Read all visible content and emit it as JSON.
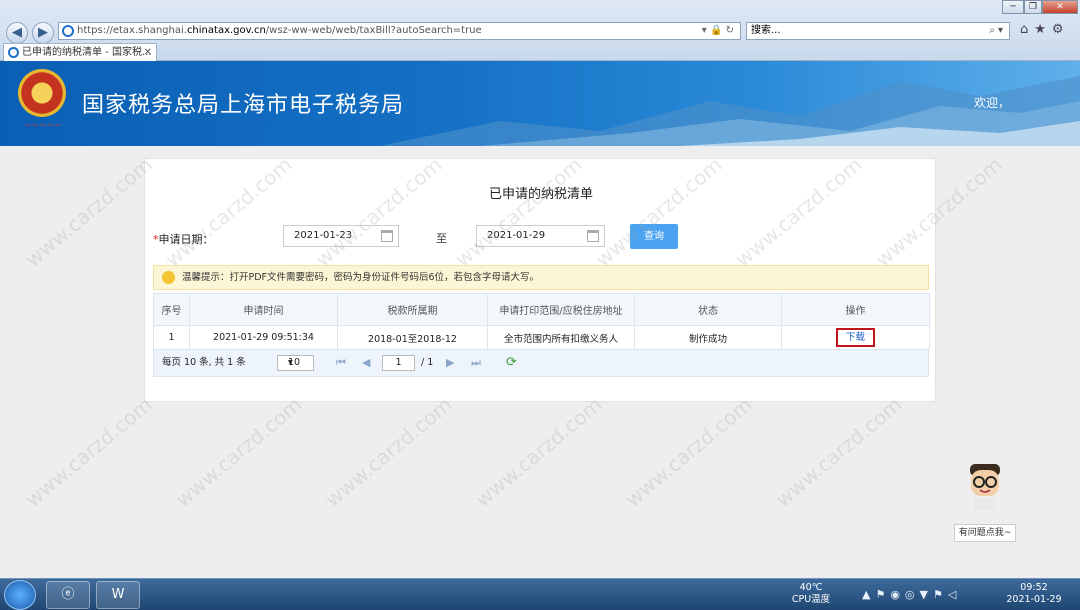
{
  "browser": {
    "url_prefix": "https://etax.shanghai.",
    "url_domain": "chinatax.gov.cn",
    "url_suffix": "/wsz-ww-web/web/taxBill?autoSearch=true",
    "search_placeholder": "搜索...",
    "tab_title": "已申请的纳税清单 - 国家税..."
  },
  "header": {
    "site_title": "国家税务总局上海市电子税务局",
    "welcome": "欢迎，"
  },
  "panel": {
    "title": "已申请的纳税清单",
    "date_label": "申请日期：",
    "date_from": "2021-01-23",
    "to_label": "至",
    "date_to": "2021-01-29",
    "query_button": "查询",
    "tip": "温馨提示：打开PDF文件需要密码，密码为身份证件号码后6位，若包含字母请大写。"
  },
  "table": {
    "headers": [
      "序号",
      "申请时间",
      "税款所属期",
      "申请打印范围/应税住房地址",
      "状态",
      "操作"
    ],
    "rows": [
      {
        "index": "1",
        "time": "2021-01-29 09:51:34",
        "period": "2018-01至2018-12",
        "scope": "全市范围内所有扣缴义务人",
        "status": "制作成功",
        "action": "下载"
      }
    ]
  },
  "pager": {
    "summary": "每页 10 条, 共 1 条",
    "page_size": "10",
    "current_page": "1",
    "total_pages": "/ 1"
  },
  "assistant": {
    "label": "有问题点我~"
  },
  "watermark": "www.carzd.com",
  "taskbar": {
    "temp": "40℃",
    "temp_label": "CPU温度",
    "time": "09:52",
    "date": "2021-01-29"
  }
}
